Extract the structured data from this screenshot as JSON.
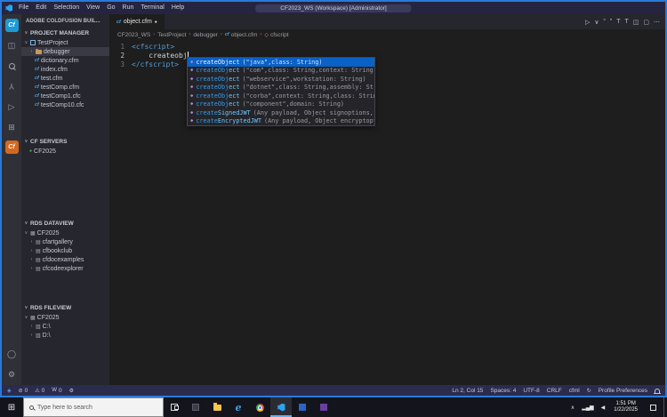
{
  "titlebar": {
    "title": "CF2023_WS (Workspace) [Administrator]",
    "menus": [
      "File",
      "Edit",
      "Selection",
      "View",
      "Go",
      "Run",
      "Terminal",
      "Help"
    ]
  },
  "activity_bar": {
    "top": [
      {
        "name": "coldfusion-builder-icon",
        "kind": "logo",
        "glyph": "Cf",
        "bg": "#1d9ad6"
      },
      {
        "name": "explorer-icon",
        "glyph": "◫"
      },
      {
        "name": "search-icon",
        "kind": "mag"
      },
      {
        "name": "source-control-icon",
        "glyph": "Y",
        "rotate": true
      },
      {
        "name": "run-debug-icon",
        "glyph": "▷"
      },
      {
        "name": "extensions-icon",
        "glyph": "⊞"
      },
      {
        "name": "coldfusion-extension-icon",
        "kind": "logo",
        "glyph": "Cf",
        "bg": "#d2691e"
      }
    ],
    "bottom": [
      {
        "name": "account-icon",
        "glyph": "◯"
      },
      {
        "name": "settings-gear-icon",
        "glyph": "⚙"
      }
    ]
  },
  "sidebar": {
    "title": "ADOBE COLDFUSION BUIL...",
    "sections": [
      {
        "title": "PROJECT MANAGER",
        "items": [
          {
            "label": "TestProject",
            "indent": 0,
            "chevron": "down",
            "icon": "project"
          },
          {
            "label": "debugger",
            "indent": 1,
            "chevron": "right",
            "icon": "folder",
            "selected": true
          },
          {
            "label": "dictionary.cfm",
            "indent": 2,
            "icon": "cfml"
          },
          {
            "label": "index.cfm",
            "indent": 2,
            "icon": "cfml"
          },
          {
            "label": "test.cfm",
            "indent": 2,
            "icon": "cfml"
          },
          {
            "label": "testComp.cfm",
            "indent": 2,
            "icon": "cfml"
          },
          {
            "label": "testComp1.cfc",
            "indent": 2,
            "icon": "cfml"
          },
          {
            "label": "testComp10.cfc",
            "indent": 2,
            "icon": "cfml"
          }
        ]
      },
      {
        "title": "CF SERVERS",
        "items": [
          {
            "label": "CF2025",
            "indent": 1,
            "icon": "server"
          }
        ]
      },
      {
        "title": "RDS DATAVIEW",
        "items": [
          {
            "label": "CF2025",
            "indent": 0,
            "chevron": "down",
            "icon": "db"
          },
          {
            "label": "cfartgallery",
            "indent": 1,
            "chevron": "right",
            "icon": "table"
          },
          {
            "label": "cfbookclub",
            "indent": 1,
            "chevron": "right",
            "icon": "table"
          },
          {
            "label": "cfdocexamples",
            "indent": 1,
            "chevron": "right",
            "icon": "table"
          },
          {
            "label": "cfcodeexplorer",
            "indent": 1,
            "chevron": "right",
            "icon": "table"
          }
        ]
      },
      {
        "title": "RDS FILEVIEW",
        "items": [
          {
            "label": "CF2025",
            "indent": 0,
            "chevron": "down",
            "icon": "db"
          },
          {
            "label": "C:\\",
            "indent": 1,
            "chevron": "right",
            "icon": "drive"
          },
          {
            "label": "D:\\",
            "indent": 1,
            "chevron": "right",
            "icon": "drive"
          }
        ]
      }
    ]
  },
  "editor": {
    "tab": {
      "label": "object.cfm",
      "modified": "●"
    },
    "actions": [
      {
        "name": "run-file-icon",
        "glyph": "▷"
      },
      {
        "name": "run-dropdown-icon",
        "glyph": "∨"
      },
      {
        "name": "quote-open-icon",
        "glyph": "“"
      },
      {
        "name": "quote-close-icon",
        "glyph": "”"
      },
      {
        "name": "text-format-icon",
        "glyph": "T"
      },
      {
        "name": "text-format-alt-icon",
        "glyph": "T"
      },
      {
        "name": "split-editor-icon",
        "glyph": "◫"
      },
      {
        "name": "layout-icon",
        "glyph": "▢"
      },
      {
        "name": "more-actions-icon",
        "glyph": "⋯"
      }
    ],
    "breadcrumbs": [
      {
        "label": "CF2023_WS"
      },
      {
        "label": "TestProject"
      },
      {
        "label": "debugger"
      },
      {
        "label": "object.cfm",
        "icon": "cfml"
      },
      {
        "label": "cfscript",
        "icon": "symbol"
      }
    ],
    "code_lines": [
      {
        "num": "1",
        "tokens": [
          {
            "cls": "tag",
            "text": "<cfscript>"
          }
        ]
      },
      {
        "num": "2",
        "active": true,
        "cursor": true,
        "tokens": [
          {
            "cls": "plain",
            "text": "    createobj"
          }
        ]
      },
      {
        "num": "3",
        "tokens": [
          {
            "cls": "tag",
            "text": "</cfscript>"
          }
        ]
      }
    ],
    "suggestions": [
      {
        "fn": "createObject",
        "args": "(\"java\",class: String)",
        "match_len": 9,
        "selected": true
      },
      {
        "fn": "createObject",
        "args": "(\"com\",class: String,context: String,…",
        "match_len": 9
      },
      {
        "fn": "createObject",
        "args": "(\"webservice\",workstation: String)",
        "match_len": 9
      },
      {
        "fn": "createObject",
        "args": "(\"dotnet\",class: String,assembly: Str…",
        "match_len": 9
      },
      {
        "fn": "createObject",
        "args": "(\"corba\",context: String,class: Strin…",
        "match_len": 9
      },
      {
        "fn": "createObject",
        "args": "(\"component\",domain: String)",
        "match_len": 9
      },
      {
        "fn": "createSignedJWT",
        "args": "(Any payload, Object signoptions, …",
        "match_len": 6
      },
      {
        "fn": "createEncryptedJWT",
        "args": "(Any payload, Object encryptopt…",
        "match_len": 6
      }
    ]
  },
  "status_bar": {
    "left": [
      {
        "name": "cf-status-icon",
        "glyph": "◈",
        "color": "#5aa7e8"
      },
      {
        "name": "errors-indicator",
        "glyph": "⊘",
        "value": "0"
      },
      {
        "name": "warnings-indicator",
        "glyph": "⚠",
        "value": "0"
      },
      {
        "name": "watch-indicator",
        "glyph": "W",
        "value": "0"
      },
      {
        "name": "wrench-icon",
        "glyph": "⚙"
      }
    ],
    "right": [
      {
        "name": "cursor-position",
        "label": "Ln 2, Col 15"
      },
      {
        "name": "indentation",
        "label": "Spaces: 4"
      },
      {
        "name": "encoding",
        "label": "UTF-8"
      },
      {
        "name": "eol-sequence",
        "label": "CRLF"
      },
      {
        "name": "language-mode",
        "label": "cfml"
      },
      {
        "name": "sync-icon",
        "glyph": "↻"
      },
      {
        "name": "profile-preferences",
        "label": "Profile Preferences"
      },
      {
        "name": "notifications-bell-icon",
        "bell": true
      }
    ]
  },
  "taskbar": {
    "start_glyph": "⊞",
    "search_placeholder": "Type here to search",
    "apps": [
      {
        "name": "task-view-icon",
        "kind": "taskview"
      },
      {
        "name": "pinned-app-icon-dark",
        "kind": "dark"
      },
      {
        "name": "file-explorer-icon",
        "kind": "folder"
      },
      {
        "name": "edge-icon",
        "kind": "edge",
        "glyph": "e"
      },
      {
        "name": "chrome-icon",
        "kind": "chrome"
      },
      {
        "name": "vscode-icon",
        "kind": "vscode",
        "active": true
      },
      {
        "name": "pinned-app-icon-blue",
        "kind": "blue"
      },
      {
        "name": "pinned-app-icon-purple",
        "kind": "purple"
      }
    ],
    "tray_icons": [
      {
        "name": "tray-expand-icon",
        "glyph": "∧"
      },
      {
        "name": "network-icon",
        "glyph": "▂▄▆"
      },
      {
        "name": "volume-icon",
        "glyph": "◀"
      }
    ],
    "clock": {
      "time": "1:51 PM",
      "date": "1/22/2025"
    }
  }
}
